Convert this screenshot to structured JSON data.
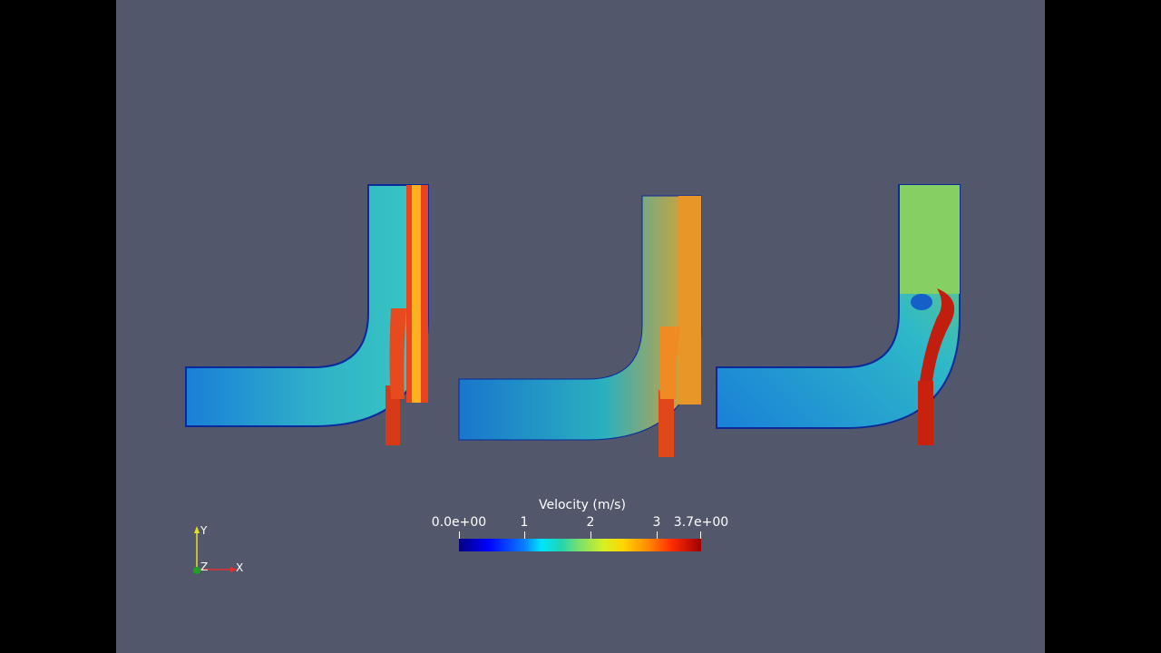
{
  "legend": {
    "title": "Velocity (m/s)",
    "ticks": [
      {
        "label": "0.0e+00",
        "value": 0.0
      },
      {
        "label": "1",
        "value": 1
      },
      {
        "label": "2",
        "value": 2
      },
      {
        "label": "3",
        "value": 3
      },
      {
        "label": "3.7e+00",
        "value": 3.7
      }
    ],
    "range": [
      0.0,
      3.7
    ],
    "colormap": [
      "#05007f",
      "#0000ff",
      "#0a7fff",
      "#00e5ff",
      "#20d4b0",
      "#7ee06a",
      "#d9f020",
      "#ffd400",
      "#ff8a00",
      "#ff2a00",
      "#a00000"
    ]
  },
  "axes_widget": {
    "x_label": "X",
    "y_label": "Y",
    "z_label": "Z",
    "x_color": "#e03030",
    "y_color": "#e6e020",
    "z_color": "#20a020"
  },
  "viewport": {
    "background": "#52576b"
  }
}
